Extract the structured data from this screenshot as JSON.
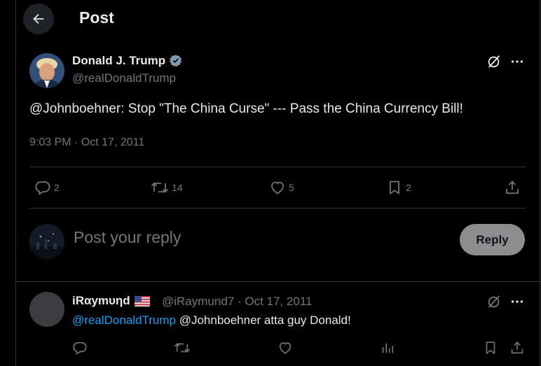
{
  "header": {
    "title": "Post"
  },
  "post": {
    "author_name": "Donald J. Trump",
    "author_handle": "@realDonaldTrump",
    "text": "@Johnboehner: Stop \"The China Curse\" --- Pass the China Currency Bill!",
    "timestamp": "9:03 PM · Oct 17, 2011",
    "stats": {
      "replies": "2",
      "reposts": "14",
      "likes": "5",
      "bookmarks": "2"
    }
  },
  "compose": {
    "placeholder": "Post your reply",
    "reply_label": "Reply"
  },
  "reply": {
    "author_name": "iRαymυηd",
    "flag": "🇺🇸",
    "author_handle": "@iRaymund7 · Oct 17, 2011",
    "mention": "@realDonaldTrump",
    "text": " @Johnboehner atta guy Donald!"
  },
  "colors": {
    "accent": "#1d9bf0",
    "verified": "#829aab",
    "muted": "#71767b",
    "background": "#000000"
  }
}
